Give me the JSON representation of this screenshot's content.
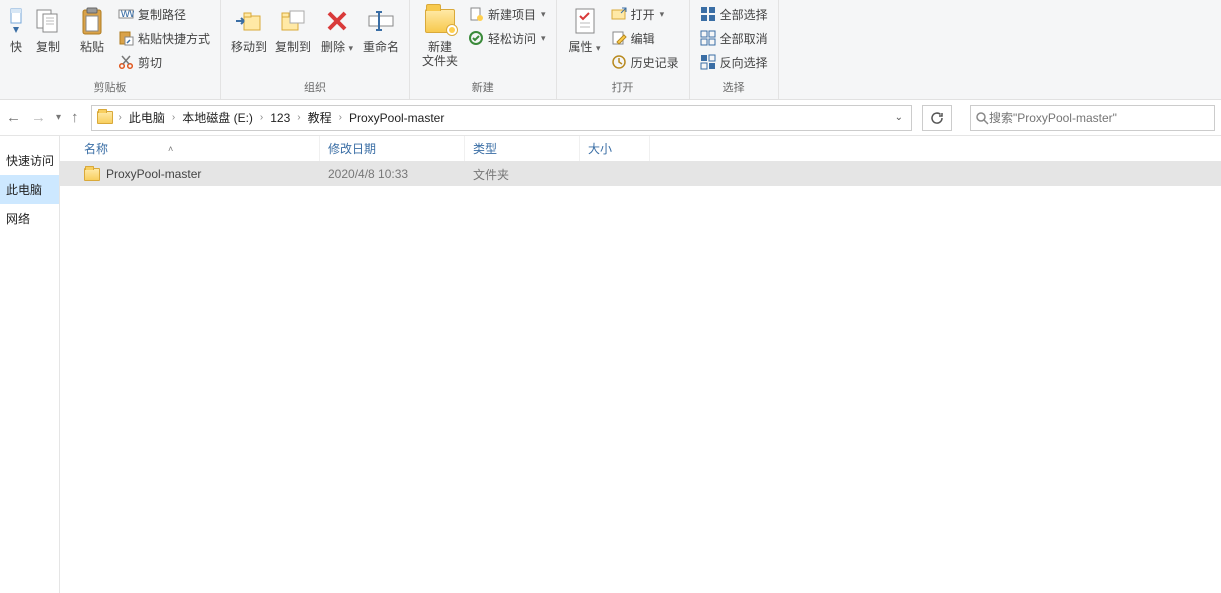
{
  "ribbon": {
    "clipboard": {
      "quick": "快",
      "copy": "复制",
      "paste": "粘贴",
      "copy_path": "复制路径",
      "paste_shortcut": "粘贴快捷方式",
      "cut": "剪切",
      "group": "剪贴板"
    },
    "organize": {
      "move_to": "移动到",
      "copy_to": "复制到",
      "delete": "删除",
      "rename": "重命名",
      "group": "组织"
    },
    "new": {
      "new_folder": "新建\n文件夹",
      "new_item": "新建项目",
      "easy_access": "轻松访问",
      "group": "新建"
    },
    "open": {
      "properties": "属性",
      "open": "打开",
      "edit": "编辑",
      "history": "历史记录",
      "group": "打开"
    },
    "select": {
      "all": "全部选择",
      "none": "全部取消",
      "invert": "反向选择",
      "group": "选择"
    }
  },
  "breadcrumbs": [
    "此电脑",
    "本地磁盘 (E:)",
    "123",
    "教程",
    "ProxyPool-master"
  ],
  "search_placeholder": "搜索\"ProxyPool-master\"",
  "sidebar": [
    {
      "label": "快速访问",
      "active": false
    },
    {
      "label": "此电脑",
      "active": true
    },
    {
      "label": "网络",
      "active": false
    }
  ],
  "columns": {
    "name": "名称",
    "date": "修改日期",
    "type": "类型",
    "size": "大小"
  },
  "rows": [
    {
      "name": "ProxyPool-master",
      "date": "2020/4/8 10:33",
      "type": "文件夹",
      "size": ""
    }
  ]
}
